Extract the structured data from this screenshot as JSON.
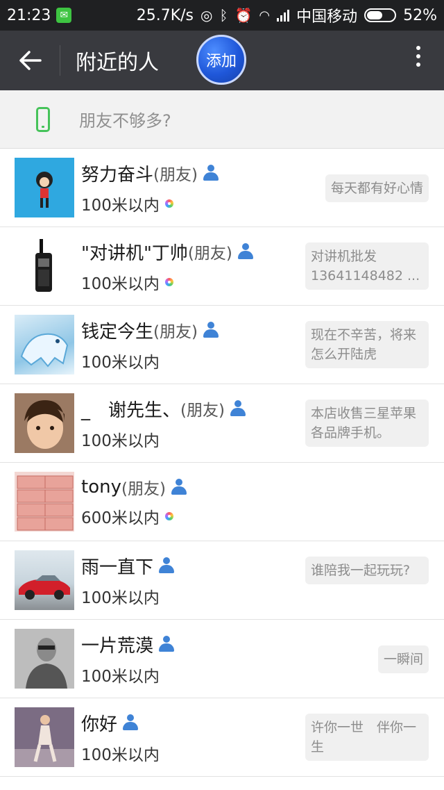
{
  "status_bar": {
    "time": "21:23",
    "net_speed": "25.7K/s",
    "carrier": "中国移动",
    "battery": "52%",
    "battery_level": 0.52,
    "icons": [
      "wechat-notification-icon",
      "hotspot-icon",
      "bluetooth-icon",
      "alarm-icon",
      "wifi-icon",
      "signal-icon",
      "battery-icon"
    ]
  },
  "appbar": {
    "title": "附近的人",
    "add_label": "添加",
    "icons": [
      "back-arrow-icon",
      "more-vertical-icon"
    ]
  },
  "tip": {
    "text": "朋友不够多?",
    "icon": "phone-icon"
  },
  "people": [
    {
      "name": "努力奋斗",
      "friend_tag": "(朋友)",
      "distance": "100米以内",
      "has_dot": true,
      "signature": "每天都有好心情"
    },
    {
      "name": "\"对讲机\"丁帅",
      "friend_tag": "(朋友)",
      "distance": "100米以内",
      "has_dot": true,
      "signature": "对讲机批发13641148482 ..."
    },
    {
      "name": "钱定今生",
      "friend_tag": "(朋友)",
      "distance": "100米以内",
      "has_dot": false,
      "signature": "现在不辛苦，将来怎么开陆虎"
    },
    {
      "name": "_　谢先生、",
      "friend_tag": "(朋友)",
      "distance": "100米以内",
      "has_dot": false,
      "signature": "本店收售三星苹果各品牌手机。"
    },
    {
      "name": "tony",
      "friend_tag": "(朋友)",
      "distance": "600米以内",
      "has_dot": true,
      "signature": ""
    },
    {
      "name": "雨一直下",
      "friend_tag": "",
      "distance": "100米以内",
      "has_dot": false,
      "signature": "谁陪我一起玩玩?"
    },
    {
      "name": "一片荒漠",
      "friend_tag": "",
      "distance": "100米以内",
      "has_dot": false,
      "signature": "一瞬间"
    },
    {
      "name": "你好",
      "friend_tag": "",
      "distance": "100米以内",
      "has_dot": false,
      "signature": "许你一世　伴你一生"
    }
  ],
  "colors": {
    "statusbar_bg": "#1f2022",
    "appbar_bg": "#393a3f",
    "accent_green": "#46c35a",
    "person_icon_blue": "#3f83d6",
    "add_button_blue": "#1f57d9"
  }
}
